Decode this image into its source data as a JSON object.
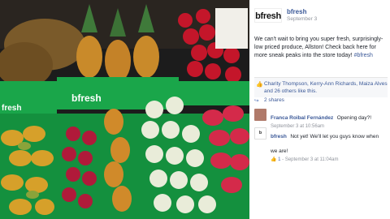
{
  "post": {
    "page_name": "bfresh",
    "logo_text": "bfresh",
    "date": "September 3",
    "body_text": "We can't wait to bring you super fresh, surprisingly-low priced produce, Allston! Check back here for more sneak peaks into the store today!",
    "hashtag": "#bfresh",
    "likes_text": "Charity Thompson, Kerry-Ann Richards, Maiza Alves and 26 others like this.",
    "shares_text": "2 shares"
  },
  "comments": [
    {
      "author": "Franca Roibal Fernández",
      "text": "Opening day?!",
      "meta": "September 3 at 10:56am",
      "avatar_color": "#b07a6a"
    },
    {
      "author": "bfresh",
      "text": "Not yet! We'll let you guys know when we are!",
      "like_count": "1",
      "meta": "September 3 at 11:04am",
      "avatar_color": "#ffffff"
    }
  ],
  "photo": {
    "crate_label": "bfresh"
  },
  "colors": {
    "brand_green": "#1aa64a",
    "link_blue": "#3b5998"
  }
}
